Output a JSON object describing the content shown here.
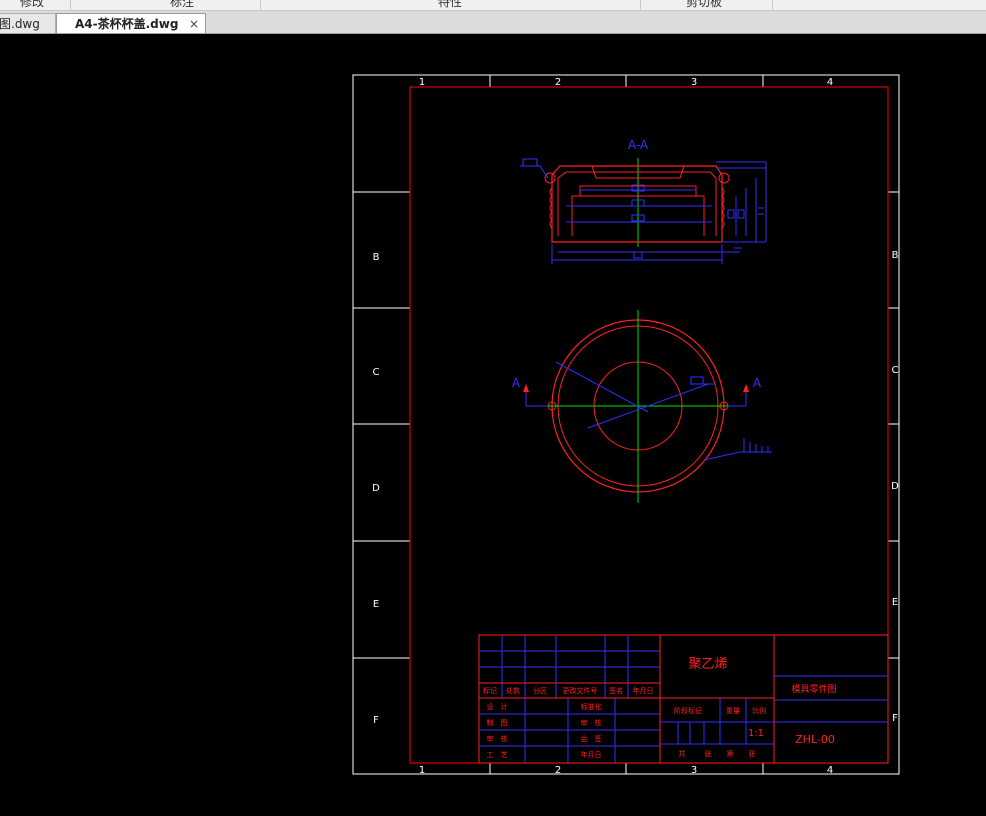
{
  "ribbon": {
    "groups": [
      "修改",
      "标注",
      "特性",
      "剪切板"
    ]
  },
  "tabs": [
    {
      "label": "图.dwg",
      "active": false
    },
    {
      "label": "A4-茶杯杯盖.dwg",
      "active": true
    }
  ],
  "close_glyph": "×",
  "drawing": {
    "section_label": "A-A",
    "arrow_label": "A",
    "border_numbers": [
      "1",
      "2",
      "3",
      "4"
    ],
    "border_letters": [
      "B",
      "C",
      "D",
      "E",
      "F"
    ],
    "title_block": {
      "material": "聚乙烯",
      "drawing_type": "模具零件图",
      "drawing_number": "ZHL-00",
      "scale_value": "1:1",
      "header_row": [
        "标记",
        "处数",
        "分区",
        "更改文件号",
        "签名",
        "年月日"
      ],
      "left_rows": [
        [
          "设　计",
          "标准化"
        ],
        [
          "制　图",
          "审　核"
        ],
        [
          "审　核",
          "会　签"
        ],
        [
          "工　艺",
          "年月日"
        ]
      ],
      "stage_label": "阶段标记",
      "weight_label": "重量",
      "scale_label": "比例",
      "sheet_row": [
        "共",
        "张",
        "第",
        "张"
      ]
    }
  },
  "colors": {
    "frame": "#ff0000",
    "dims": "#2020ff",
    "center": "#00e000",
    "text_red": "#ff2020",
    "border": "#ffffff"
  }
}
